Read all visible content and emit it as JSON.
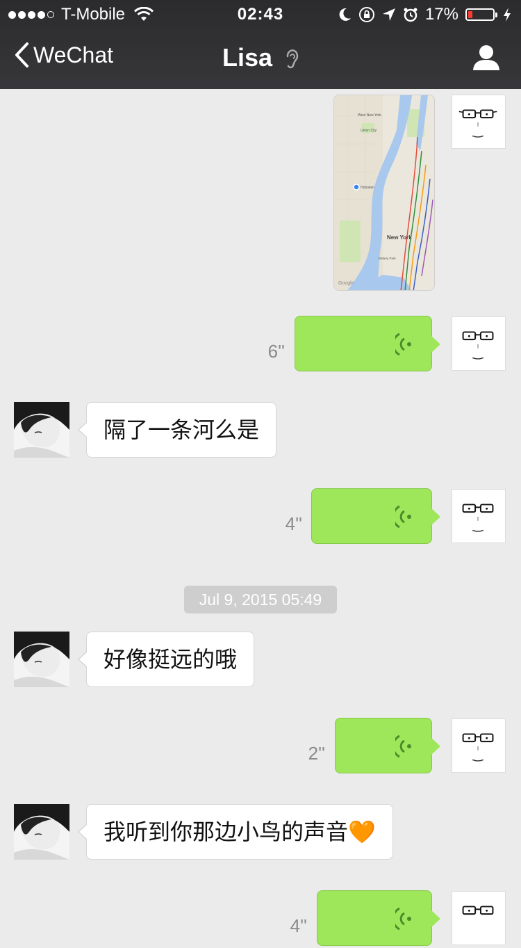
{
  "status_bar": {
    "carrier": "T-Mobile",
    "time": "02:43",
    "battery": "17%",
    "battery_level": 0.17
  },
  "nav": {
    "back_label": "WeChat",
    "title": "Lisa"
  },
  "messages": {
    "voice1_duration": "6''",
    "text1": "隔了一条河么是",
    "voice2_duration": "4''",
    "timestamp": "Jul 9, 2015 05:49",
    "text2": "好像挺远的哦",
    "voice3_duration": "2''",
    "text3": "我听到你那边小鸟的声音🧡",
    "voice4_duration": "4''"
  },
  "map_labels": {
    "west_new_york": "West New York",
    "union_city": "Union City",
    "hoboken": "Hoboken",
    "new_york": "New York",
    "battery_park": "Battery Park",
    "google": "Google"
  },
  "colors": {
    "nav_bg": "#2b2b2d",
    "voice_bubble": "#9ee65a",
    "chat_bg": "#ebebeb",
    "battery_low": "#ff3b30"
  }
}
